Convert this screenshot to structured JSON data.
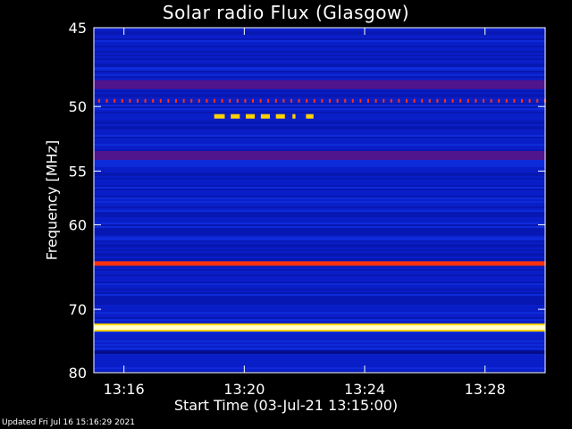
{
  "chart_data": {
    "type": "heatmap",
    "title": "Solar radio Flux (Glasgow)",
    "xlabel": "Start Time (03-Jul-21 13:15:00)",
    "ylabel": "Frequency [MHz]",
    "x_ticks": [
      "13:16",
      "13:20",
      "13:24",
      "13:28"
    ],
    "x_tick_minutes": [
      1,
      5,
      9,
      13
    ],
    "x_range_minutes": [
      0,
      15
    ],
    "y_ticks": [
      45,
      50,
      55,
      60,
      70,
      80
    ],
    "y_range": [
      45,
      80
    ],
    "y_scale": "reciprocal",
    "colors": {
      "background": "#0a1ec8",
      "dark_band": "#050c8c",
      "purple_band": "#50148c",
      "red_line": "#ff3210",
      "bright_line": "#ffffd0",
      "yellow_mark": "#ffd200"
    },
    "emission_lines_mhz": [
      {
        "freq": 48.5,
        "level": "purple"
      },
      {
        "freq": 49.6,
        "level": "dotted-red"
      },
      {
        "freq": 53.7,
        "level": "purple"
      },
      {
        "freq": 64.2,
        "level": "red"
      },
      {
        "freq": 72.6,
        "level": "bright"
      },
      {
        "freq": 76.5,
        "level": "dark"
      }
    ],
    "bursts": [
      {
        "start_min": 4.0,
        "end_min": 4.35,
        "freq": 50.7
      },
      {
        "start_min": 4.55,
        "end_min": 4.85,
        "freq": 50.7
      },
      {
        "start_min": 5.05,
        "end_min": 5.35,
        "freq": 50.7
      },
      {
        "start_min": 5.55,
        "end_min": 5.85,
        "freq": 50.7
      },
      {
        "start_min": 6.05,
        "end_min": 6.35,
        "freq": 50.7
      },
      {
        "start_min": 6.6,
        "end_min": 6.7,
        "freq": 50.7
      },
      {
        "start_min": 7.05,
        "end_min": 7.3,
        "freq": 50.7
      }
    ]
  },
  "footer": {
    "updated": "Updated Fri Jul 16 15:16:29 2021"
  }
}
